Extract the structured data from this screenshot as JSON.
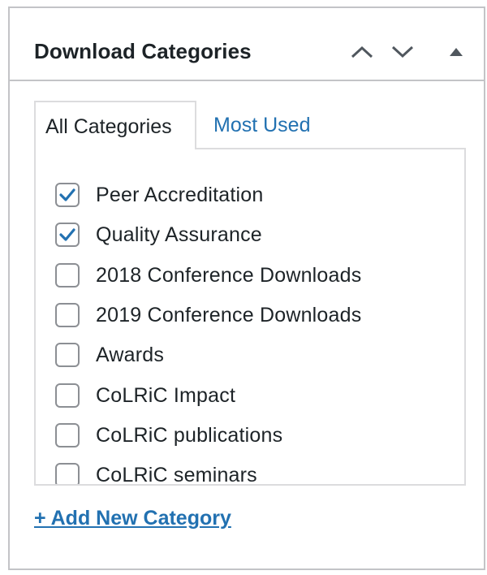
{
  "panel": {
    "title": "Download Categories"
  },
  "icons": {
    "move_up": "chevron-up-icon",
    "move_down": "chevron-down-icon",
    "toggle": "triangle-up-icon"
  },
  "tabs": {
    "all": "All Categories",
    "most_used": "Most Used"
  },
  "categories": [
    {
      "label": "Peer Accreditation",
      "checked": true
    },
    {
      "label": "Quality Assurance",
      "checked": true
    },
    {
      "label": "2018 Conference Downloads",
      "checked": false
    },
    {
      "label": "2019 Conference Downloads",
      "checked": false
    },
    {
      "label": "Awards",
      "checked": false
    },
    {
      "label": "CoLRiC Impact",
      "checked": false
    },
    {
      "label": "CoLRiC publications",
      "checked": false
    },
    {
      "label": "CoLRiC seminars",
      "checked": false
    }
  ],
  "add_new_label": "+ Add New Category",
  "colors": {
    "link": "#2271b1",
    "text": "#1d2327",
    "border": "#c3c4c7",
    "checkmark": "#2271b1"
  }
}
